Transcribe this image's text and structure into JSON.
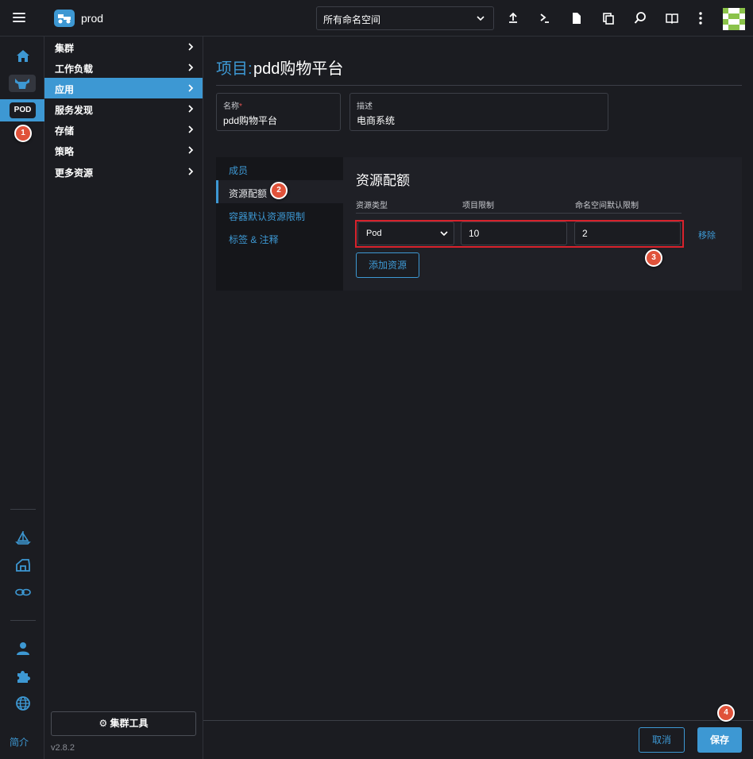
{
  "colors": {
    "accent": "#3d98d3",
    "background": "#1b1c21",
    "highlight": "#d8222c",
    "step_marker": "#e0523a"
  },
  "header": {
    "cluster_name": "prod",
    "namespace_select": "所有命名空间",
    "icons": [
      "upload-icon",
      "terminal-icon",
      "file-icon",
      "copy-icon",
      "search-icon",
      "book-icon",
      "more-vert-icon"
    ]
  },
  "rail": {
    "pod_badge": "POD",
    "intro": "简介",
    "icons": [
      "home-icon",
      "longhorn-icon",
      "helm-icon",
      "fleet-icon",
      "network-icon",
      "user-icon",
      "extension-icon",
      "globe-icon"
    ]
  },
  "nav": {
    "items": [
      {
        "label": "集群"
      },
      {
        "label": "工作负载"
      },
      {
        "label": "应用"
      },
      {
        "label": "服务发现"
      },
      {
        "label": "存储"
      },
      {
        "label": "策略"
      },
      {
        "label": "更多资源"
      }
    ],
    "cluster_tools": "集群工具",
    "version": "v2.8.2"
  },
  "page": {
    "title_prefix": "项目:",
    "title_name": "pdd购物平台",
    "name_label": "名称",
    "name_required": "*",
    "name_value": "pdd购物平台",
    "desc_label": "描述",
    "desc_value": "电商系统"
  },
  "tabs": [
    {
      "label": "成员"
    },
    {
      "label": "资源配额"
    },
    {
      "label": "容器默认资源限制"
    },
    {
      "label": "标签 & 注释"
    }
  ],
  "quota": {
    "title": "资源配额",
    "columns": [
      "资源类型",
      "项目限制",
      "命名空间默认限制"
    ],
    "row": {
      "resource_type": "Pod",
      "project_limit": "10",
      "namespace_default_limit": "2"
    },
    "remove": "移除",
    "add_resource": "添加资源"
  },
  "footer": {
    "cancel": "取消",
    "save": "保存"
  },
  "steps": [
    "1",
    "2",
    "3",
    "4"
  ]
}
